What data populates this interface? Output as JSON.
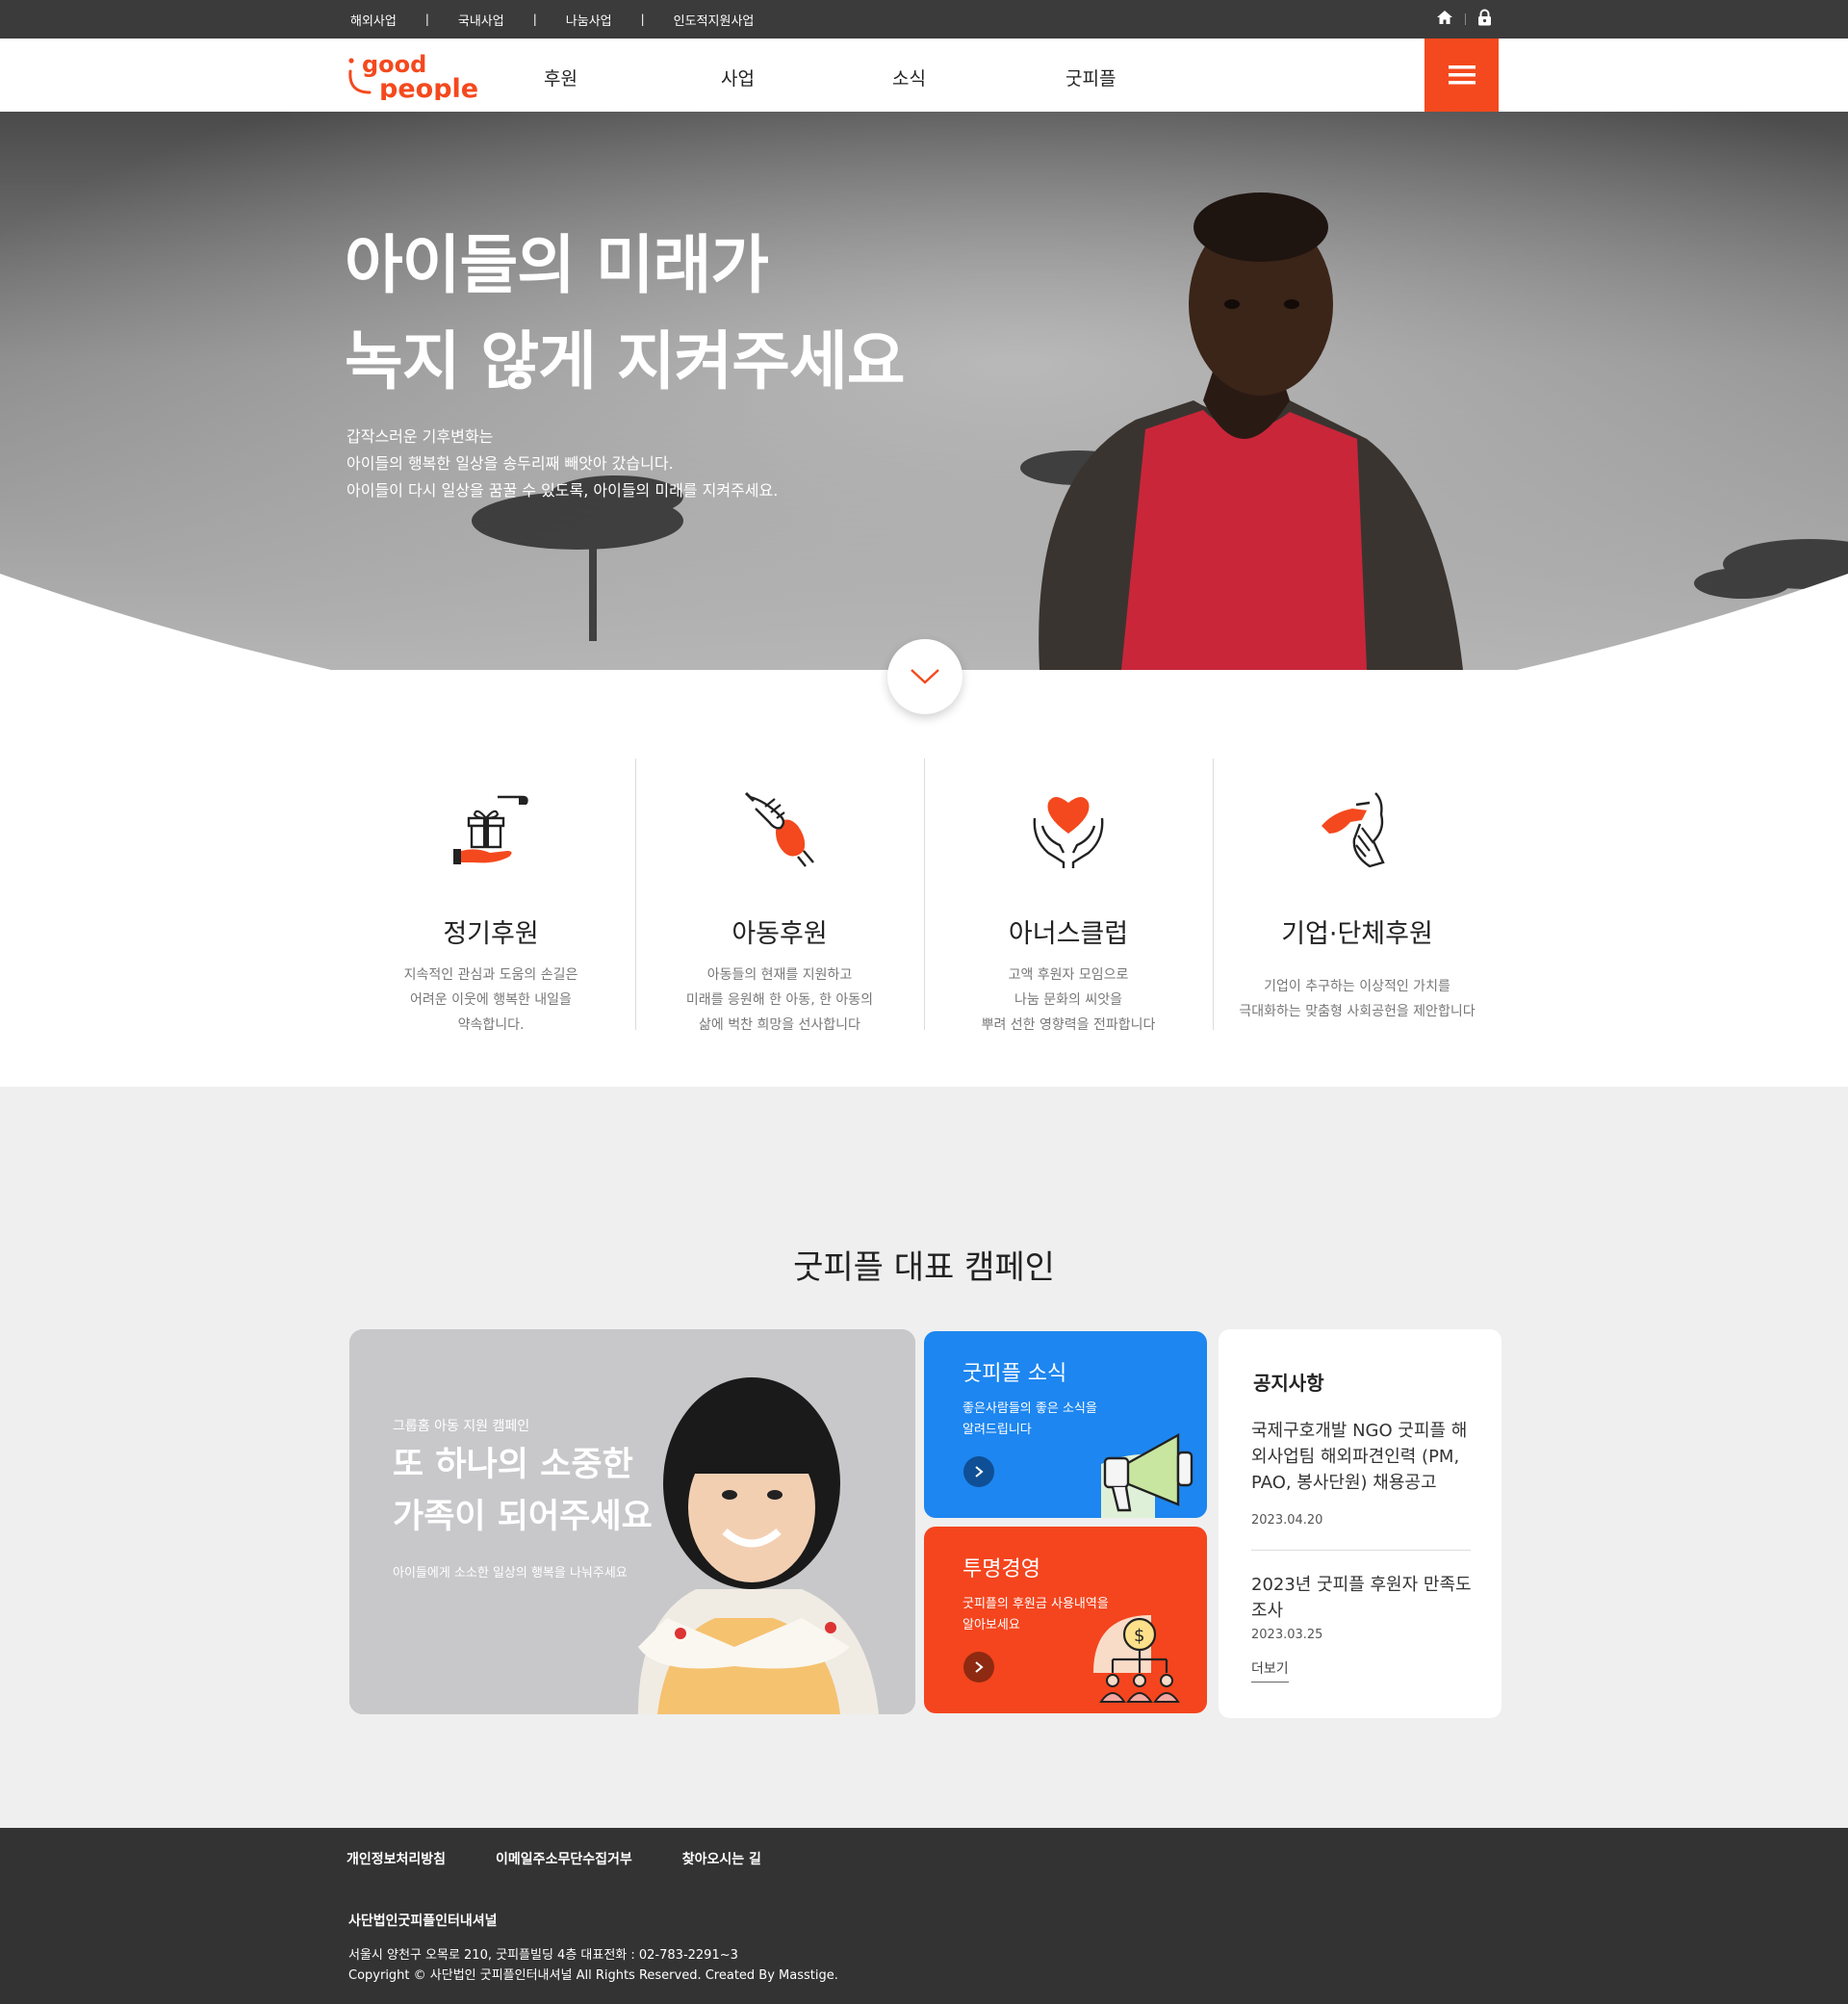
{
  "topbar": {
    "links": [
      "해외사업",
      "국내사업",
      "나눔사업",
      "인도적지원사업"
    ],
    "icons": [
      "home-icon",
      "lock-icon"
    ]
  },
  "header": {
    "logo_line1": "good",
    "logo_line2": "people",
    "nav": [
      "후원",
      "사업",
      "소식",
      "굿피플"
    ],
    "menu_icon": "hamburger-icon"
  },
  "hero": {
    "title_line1": "아이들의 미래가",
    "title_line2": "녹지 않게 지켜주세요",
    "desc_line1": "갑작스러운 기후변화는",
    "desc_line2": "아이들의 행복한 일상을 송두리째 빼앗아 갔습니다.",
    "desc_line3": "아이들이 다시 일상을 꿈꿀 수 있도록, 아이들의 미래를 지켜주세요."
  },
  "categories": [
    {
      "title": "정기후원",
      "icon": "gift-hand-icon",
      "desc": [
        "지속적인 관심과 도움의 손길은",
        "어려운 이웃에 행복한 내일을",
        "약속합니다."
      ]
    },
    {
      "title": "아동후원",
      "icon": "holding-hands-icon",
      "desc": [
        "아동들의 현재를 지원하고",
        "미래를 응원해 한 아동, 한 아동의",
        "삶에 벅찬 희망을 선사합니다"
      ]
    },
    {
      "title": "아너스클럽",
      "icon": "heart-hands-icon",
      "desc": [
        "고액 후원자 모임으로",
        "나눔 문화의 씨앗을",
        "뿌려 선한 영향력을 전파합니다"
      ]
    },
    {
      "title": "기업·단체후원",
      "icon": "handshake-icon",
      "desc": [
        "기업이 추구하는 이상적인 가치를",
        "극대화하는 맞춤형 사회공헌을 제안합니다"
      ]
    }
  ],
  "campaign": {
    "section_title": "굿피플 대표 캠페인",
    "feature": {
      "kicker": "그룹홈 아동 지원 캠페인",
      "title_line1": "또 하나의 소중한",
      "title_line2": "가족이 되어주세요",
      "sub": "아이들에게 소소한 일상의 행복을 나눠주세요"
    },
    "news": {
      "title": "굿피플 소식",
      "desc_line1": "좋은사람들의 좋은 소식을",
      "desc_line2": "알려드립니다",
      "icon": "megaphone-icon",
      "color": "#1d86f0"
    },
    "transparency": {
      "title": "투명경영",
      "desc_line1": "굿피플의 후원금 사용내역을",
      "desc_line2": "알아보세요",
      "icon": "money-tree-icon",
      "color": "#f4451e"
    },
    "notice": {
      "heading": "공지사항",
      "items": [
        {
          "title": "국제구호개발 NGO 굿피플 해외사업팀 해외파견인력 (PM, PAO, 봉사단원) 채용공고",
          "date": "2023.04.20"
        },
        {
          "title": "2023년 굿피플 후원자 만족도 조사",
          "date": "2023.03.25"
        }
      ],
      "more": "더보기"
    }
  },
  "footer": {
    "links": [
      "개인정보처리방침",
      "이메일주소무단수집거부",
      "찾아오시는 길"
    ],
    "org": "사단법인굿피플인터내셔널",
    "address": "서울시 양천구 오목로 210, 굿피플빌딩 4층 대표전화 : 02-783-2291~3",
    "copyright": "Copyright © 사단법인 굿피플인터내셔널 All Rights Reserved. Created By Masstige."
  },
  "colors": {
    "accent": "#f4491e",
    "blue": "#1d86f0",
    "topbar": "#3b3b3b",
    "footer": "#333333",
    "section_bg": "#efefef"
  }
}
